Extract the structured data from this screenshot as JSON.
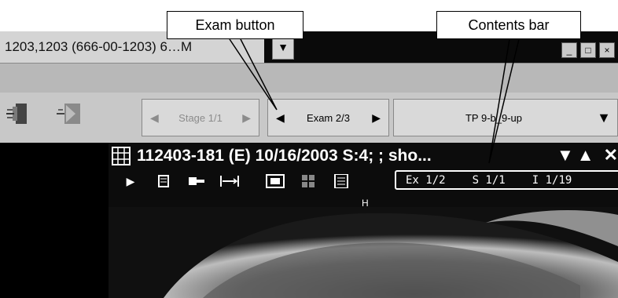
{
  "callouts": {
    "exam_button": "Exam button",
    "contents_bar": "Contents bar"
  },
  "window": {
    "title": "1203,1203 (666-00-1203) 6…M",
    "dropdown_icon": "chevron-down-icon",
    "minimize": "_",
    "maximize": "□",
    "close": "×"
  },
  "toolbar": {
    "stage": {
      "label": "Stage 1/1",
      "prev": "◀",
      "next": "▶",
      "enabled": false
    },
    "exam": {
      "label": "Exam 2/3",
      "prev": "◀",
      "next": "▶",
      "enabled": true
    },
    "tp": {
      "label": "TP 9-b_9-up",
      "arrow": "▼"
    }
  },
  "viewport": {
    "title": "112403-181 (E) 10/16/2003 S:4; ; sho...",
    "contents": {
      "exam": "Ex 1/2",
      "series": "S 1/1",
      "image": "I 1/19"
    },
    "orientation": "H"
  },
  "colors": {
    "titlebar": "#0a0a0a",
    "toolbar": "#c8c8c8",
    "viewport_bg": "#0c0c0c"
  }
}
